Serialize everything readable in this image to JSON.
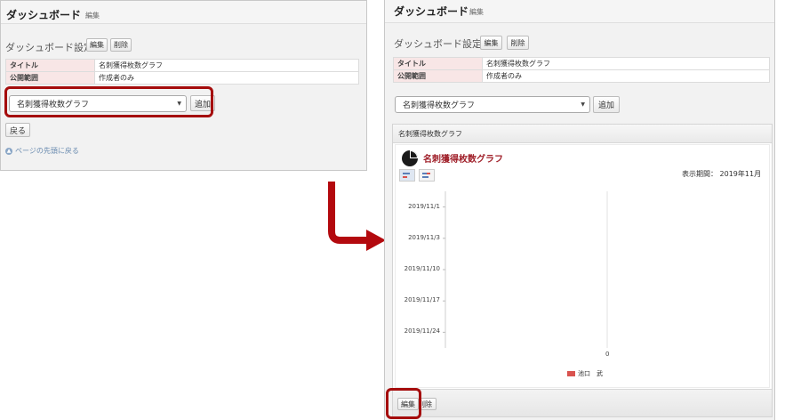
{
  "left": {
    "header_title": "ダッシュボード",
    "header_sub": "編集",
    "section_label": "ダッシュボード設定",
    "edit_button": "編集",
    "delete_button": "削除",
    "settings": [
      {
        "key": "タイトル",
        "value": "名刺獲得枚数グラフ"
      },
      {
        "key": "公開範囲",
        "value": "作成者のみ"
      }
    ],
    "widget_select_value": "名刺獲得枚数グラフ",
    "add_button": "追加",
    "back_button": "戻る",
    "page_top_link": "ページの先頭に戻る"
  },
  "right": {
    "header_title": "ダッシュボード",
    "header_sub": "編集",
    "section_label": "ダッシュボード設定",
    "edit_button": "編集",
    "delete_button": "削除",
    "settings": [
      {
        "key": "タイトル",
        "value": "名刺獲得枚数グラフ"
      },
      {
        "key": "公開範囲",
        "value": "作成者のみ"
      }
    ],
    "widget_select_value": "名刺獲得枚数グラフ",
    "add_button": "追加",
    "widget_header": "名刺獲得枚数グラフ",
    "chart_title": "名刺獲得枚数グラフ",
    "period_label": "表示期間： 2019年11月",
    "footer_edit_button": "編集",
    "footer_delete_button": "削除"
  },
  "colors": {
    "highlight": "#a50c0c",
    "chart_title": "#a0202a",
    "series": "#d9534f"
  },
  "icons": {
    "pie_chart": "pie-chart-icon",
    "bar_type": "bar-chart-icon",
    "flow": "arrow-down-right-icon"
  },
  "chart_data": {
    "type": "bar",
    "orientation": "horizontal",
    "categories": [
      "2019/11/1",
      "2019/11/3",
      "2019/11/10",
      "2019/11/17",
      "2019/11/24"
    ],
    "series": [
      {
        "name": "池口　武",
        "values": [
          0,
          0,
          0,
          0,
          0
        ]
      }
    ],
    "xticks": [
      "0"
    ],
    "legend_position": "bottom",
    "grid": false
  }
}
